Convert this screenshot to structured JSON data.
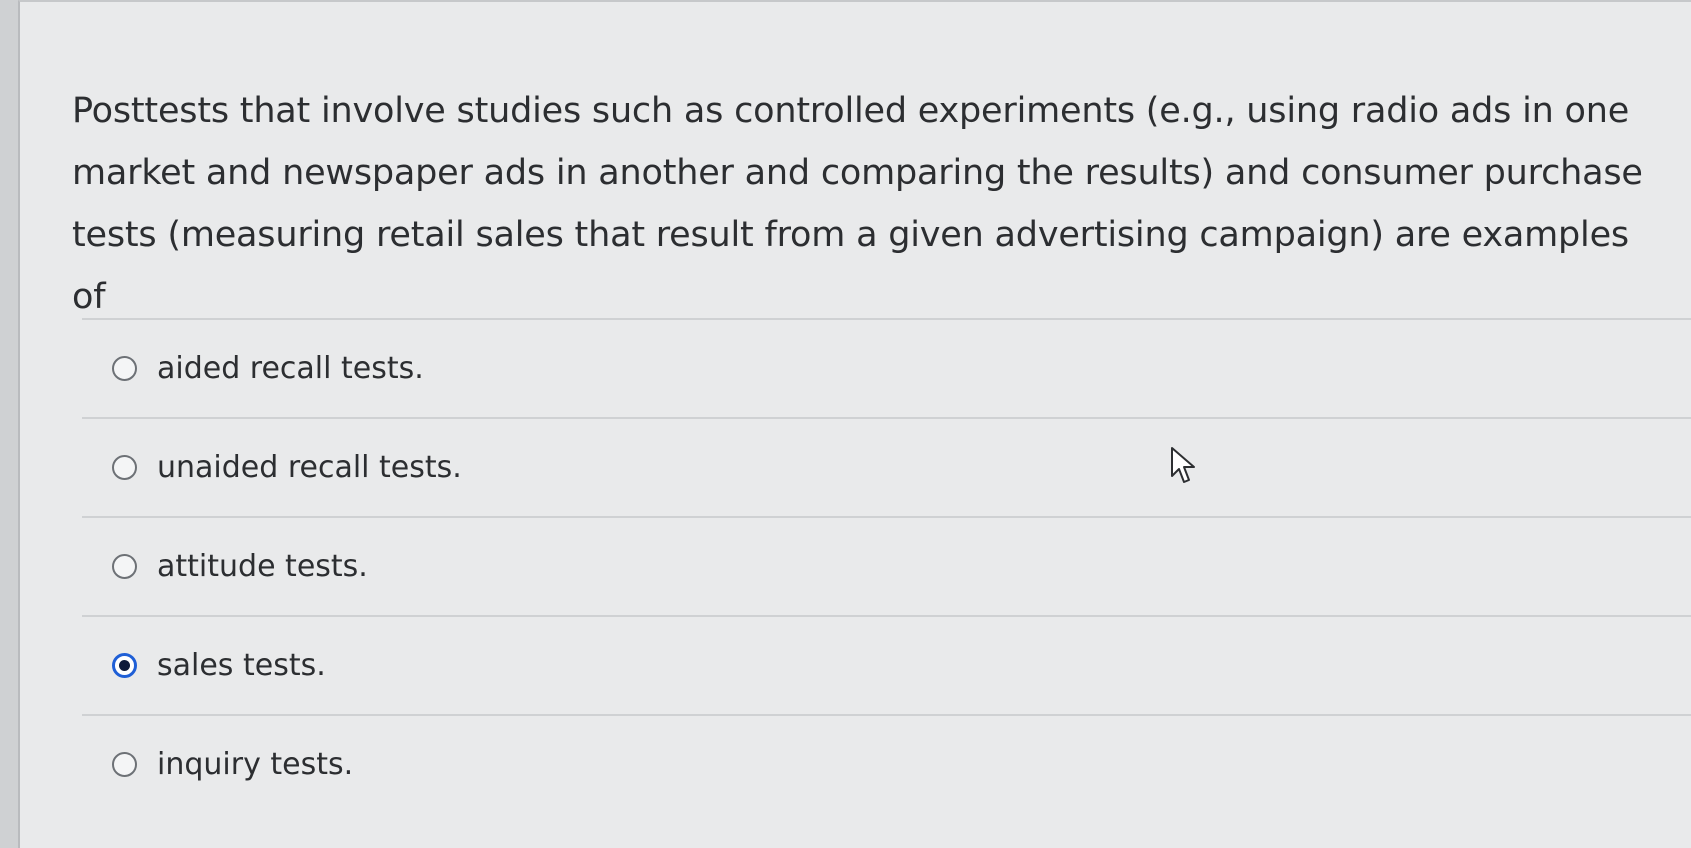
{
  "question": {
    "text": "Posttests that involve studies such as controlled experiments (e.g., using radio ads in one market and newspaper ads in another and comparing the results) and consumer purchase tests (measuring retail sales that result from a given advertising campaign) are examples of"
  },
  "options": [
    {
      "label": "aided recall tests.",
      "selected": false
    },
    {
      "label": "unaided recall tests.",
      "selected": false
    },
    {
      "label": "attitude tests.",
      "selected": false
    },
    {
      "label": "sales tests.",
      "selected": true
    },
    {
      "label": "inquiry tests.",
      "selected": false
    }
  ],
  "colors": {
    "accent": "#1f5fd6",
    "text": "#2c2e31",
    "background": "#e9eaeb"
  },
  "icons": {
    "cursor": "mouse-pointer-icon",
    "radio": "radio-button-icon"
  }
}
